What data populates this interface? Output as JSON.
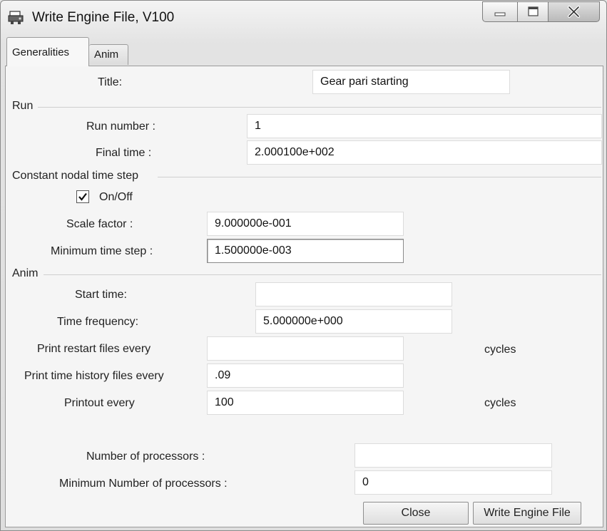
{
  "window": {
    "title": "Write Engine File, V100"
  },
  "tabs": [
    {
      "label": "Generalities",
      "active": true
    },
    {
      "label": "Anim",
      "active": false
    }
  ],
  "general": {
    "title_label": "Title:",
    "title_value": "Gear pari starting"
  },
  "run": {
    "section": "Run",
    "run_number_label": "Run number :",
    "run_number_value": "1",
    "final_time_label": "Final time :",
    "final_time_value": "2.000100e+002"
  },
  "timestep": {
    "section": "Constant nodal time step",
    "onoff_label": "On/Off",
    "onoff_checked": true,
    "scale_factor_label": "Scale factor :",
    "scale_factor_value": "9.000000e-001",
    "min_time_step_label": "Minimum time step :",
    "min_time_step_value": "1.500000e-003"
  },
  "anim": {
    "section": "Anim",
    "start_time_label": "Start time:",
    "start_time_value": "",
    "time_frequency_label": "Time frequency:",
    "time_frequency_value": "5.000000e+000",
    "print_restart_label": "Print restart files every",
    "print_restart_value": "",
    "print_restart_unit": "cycles",
    "print_history_label": "Print time history files every",
    "print_history_value": ".09",
    "printout_label": "Printout every",
    "printout_value": "100",
    "printout_unit": "cycles"
  },
  "processors": {
    "num_label": "Number of processors :",
    "num_value": "",
    "min_label": "Minimum Number of processors :",
    "min_value": "0"
  },
  "buttons": {
    "close": "Close",
    "write": "Write Engine File"
  }
}
